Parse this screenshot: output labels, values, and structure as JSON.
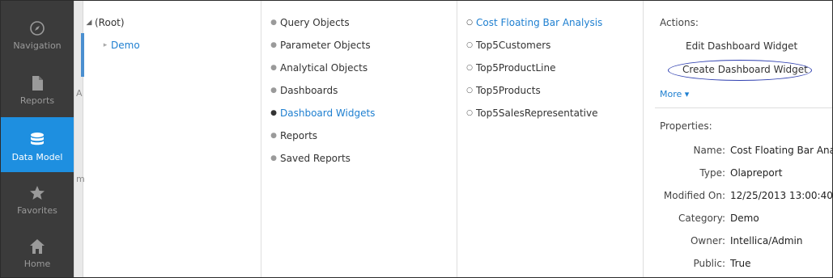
{
  "nav": {
    "items": [
      {
        "label": "Navigation",
        "icon": "compass-icon"
      },
      {
        "label": "Reports",
        "icon": "document-icon"
      },
      {
        "label": "Data Model",
        "icon": "database-icon"
      },
      {
        "label": "Favorites",
        "icon": "star-icon"
      },
      {
        "label": "Home",
        "icon": "home-icon"
      }
    ],
    "active": "Data Model",
    "accent": "#1e8fe0"
  },
  "background_fragments": {
    "a": "A",
    "m": "m"
  },
  "tree": {
    "root_label": "(Root)",
    "child_label": "Demo",
    "root_toggle": "◢",
    "child_toggle": "▸"
  },
  "categories": {
    "items": [
      "Query Objects",
      "Parameter Objects",
      "Analytical Objects",
      "Dashboards",
      "Dashboard Widgets",
      "Reports",
      "Saved Reports"
    ],
    "selected": "Dashboard Widgets"
  },
  "objects": {
    "items": [
      "Cost Floating Bar Analysis",
      "Top5Customers",
      "Top5ProductLine",
      "Top5Products",
      "Top5SalesRepresentative"
    ],
    "selected": "Cost Floating Bar Analysis"
  },
  "actions": {
    "title": "Actions:",
    "edit": "Edit Dashboard Widget",
    "create": "Create Dashboard Widget",
    "more": "More ▾"
  },
  "properties": {
    "title": "Properties:",
    "rows": [
      {
        "label": "Name:",
        "value": "Cost Floating Bar Analys"
      },
      {
        "label": "Type:",
        "value": "Olapreport"
      },
      {
        "label": "Modified On:",
        "value": "12/25/2013 13:00:40"
      },
      {
        "label": "Category:",
        "value": "Demo"
      },
      {
        "label": "Owner:",
        "value": "Intellica/Admin"
      },
      {
        "label": "Public:",
        "value": "True"
      }
    ]
  },
  "colors": {
    "link": "#1e7fd0",
    "highlight_circle": "#2e3fb0"
  }
}
